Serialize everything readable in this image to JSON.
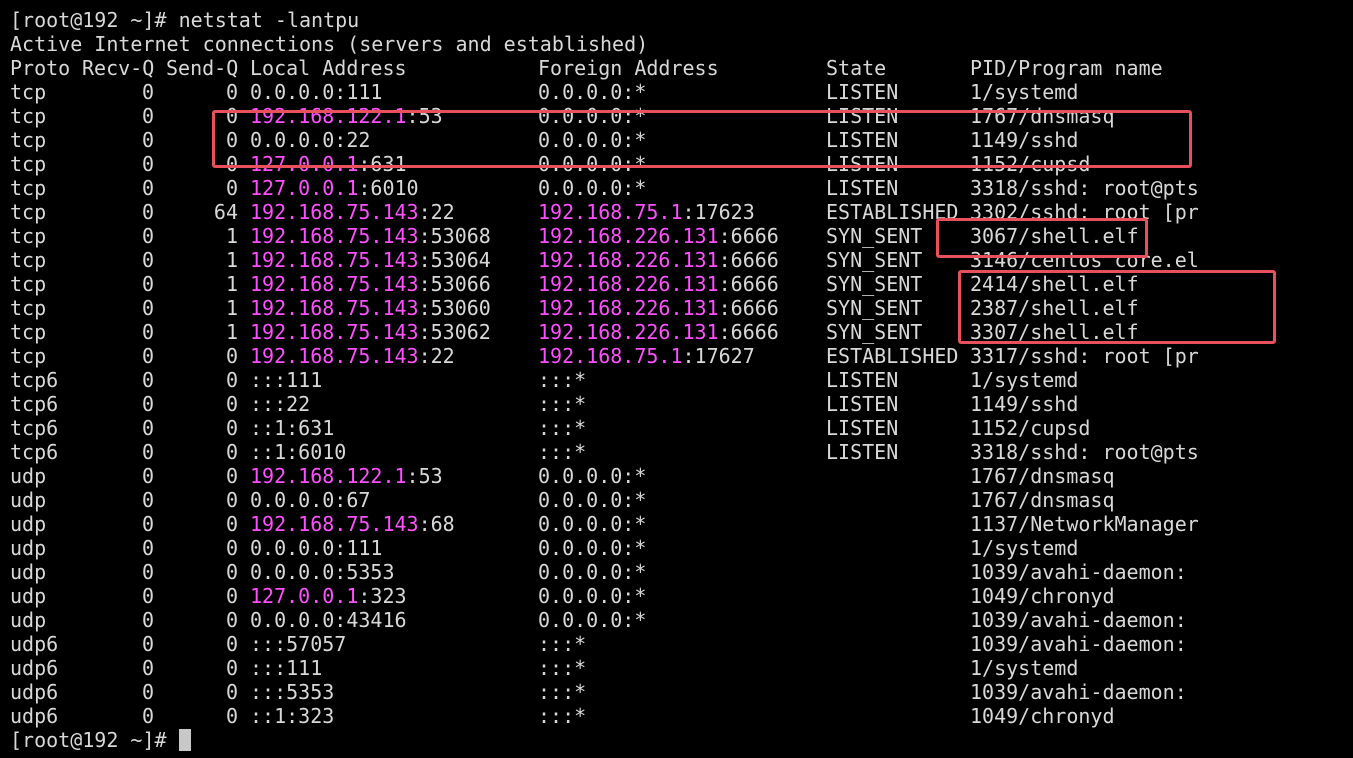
{
  "terminal": {
    "prompt": "[root@192 ~]#",
    "command": "netstat -lantpu",
    "summary_line": "Active Internet connections (servers and established)",
    "headers": {
      "proto": "Proto",
      "recv_q": "Recv-Q",
      "send_q": "Send-Q",
      "local": "Local Address",
      "foreign": "Foreign Address",
      "state": "State",
      "program": "PID/Program name"
    },
    "rows": [
      {
        "proto": "tcp",
        "recv": "0",
        "send": "0",
        "local_ip": "0.0.0.0",
        "local_ip_hl": false,
        "local_port": ":111",
        "foreign_ip": "0.0.0.0",
        "foreign_ip_hl": false,
        "foreign_port": ":*",
        "state": "LISTEN",
        "program": "1/systemd"
      },
      {
        "proto": "tcp",
        "recv": "0",
        "send": "0",
        "local_ip": "192.168.122.1",
        "local_ip_hl": true,
        "local_port": ":53",
        "foreign_ip": "0.0.0.0",
        "foreign_ip_hl": false,
        "foreign_port": ":*",
        "state": "LISTEN",
        "program": "1767/dnsmasq"
      },
      {
        "proto": "tcp",
        "recv": "0",
        "send": "0",
        "local_ip": "0.0.0.0",
        "local_ip_hl": false,
        "local_port": ":22",
        "foreign_ip": "0.0.0.0",
        "foreign_ip_hl": false,
        "foreign_port": ":*",
        "state": "LISTEN",
        "program": "1149/sshd"
      },
      {
        "proto": "tcp",
        "recv": "0",
        "send": "0",
        "local_ip": "127.0.0.1",
        "local_ip_hl": true,
        "local_port": ":631",
        "foreign_ip": "0.0.0.0",
        "foreign_ip_hl": false,
        "foreign_port": ":*",
        "state": "LISTEN",
        "program": "1152/cupsd"
      },
      {
        "proto": "tcp",
        "recv": "0",
        "send": "0",
        "local_ip": "127.0.0.1",
        "local_ip_hl": true,
        "local_port": ":6010",
        "foreign_ip": "0.0.0.0",
        "foreign_ip_hl": false,
        "foreign_port": ":*",
        "state": "LISTEN",
        "program": "3318/sshd: root@pts"
      },
      {
        "proto": "tcp",
        "recv": "0",
        "send": "64",
        "local_ip": "192.168.75.143",
        "local_ip_hl": true,
        "local_port": ":22",
        "foreign_ip": "192.168.75.1",
        "foreign_ip_hl": true,
        "foreign_port": ":17623",
        "state": "ESTABLISHED",
        "program": "3302/sshd: root [pr"
      },
      {
        "proto": "tcp",
        "recv": "0",
        "send": "1",
        "local_ip": "192.168.75.143",
        "local_ip_hl": true,
        "local_port": ":53068",
        "foreign_ip": "192.168.226.131",
        "foreign_ip_hl": true,
        "foreign_port": ":6666",
        "state": "SYN_SENT",
        "program": "3067/shell.elf"
      },
      {
        "proto": "tcp",
        "recv": "0",
        "send": "1",
        "local_ip": "192.168.75.143",
        "local_ip_hl": true,
        "local_port": ":53064",
        "foreign_ip": "192.168.226.131",
        "foreign_ip_hl": true,
        "foreign_port": ":6666",
        "state": "SYN_SENT",
        "program": "3146/centos core.el"
      },
      {
        "proto": "tcp",
        "recv": "0",
        "send": "1",
        "local_ip": "192.168.75.143",
        "local_ip_hl": true,
        "local_port": ":53066",
        "foreign_ip": "192.168.226.131",
        "foreign_ip_hl": true,
        "foreign_port": ":6666",
        "state": "SYN_SENT",
        "program": "2414/shell.elf"
      },
      {
        "proto": "tcp",
        "recv": "0",
        "send": "1",
        "local_ip": "192.168.75.143",
        "local_ip_hl": true,
        "local_port": ":53060",
        "foreign_ip": "192.168.226.131",
        "foreign_ip_hl": true,
        "foreign_port": ":6666",
        "state": "SYN_SENT",
        "program": "2387/shell.elf"
      },
      {
        "proto": "tcp",
        "recv": "0",
        "send": "1",
        "local_ip": "192.168.75.143",
        "local_ip_hl": true,
        "local_port": ":53062",
        "foreign_ip": "192.168.226.131",
        "foreign_ip_hl": true,
        "foreign_port": ":6666",
        "state": "SYN_SENT",
        "program": "3307/shell.elf"
      },
      {
        "proto": "tcp",
        "recv": "0",
        "send": "0",
        "local_ip": "192.168.75.143",
        "local_ip_hl": true,
        "local_port": ":22",
        "foreign_ip": "192.168.75.1",
        "foreign_ip_hl": true,
        "foreign_port": ":17627",
        "state": "ESTABLISHED",
        "program": "3317/sshd: root [pr"
      },
      {
        "proto": "tcp6",
        "recv": "0",
        "send": "0",
        "local_ip": "",
        "local_ip_hl": false,
        "local_port": ":::111",
        "foreign_ip": "",
        "foreign_ip_hl": false,
        "foreign_port": ":::*",
        "state": "LISTEN",
        "program": "1/systemd"
      },
      {
        "proto": "tcp6",
        "recv": "0",
        "send": "0",
        "local_ip": "",
        "local_ip_hl": false,
        "local_port": ":::22",
        "foreign_ip": "",
        "foreign_ip_hl": false,
        "foreign_port": ":::*",
        "state": "LISTEN",
        "program": "1149/sshd"
      },
      {
        "proto": "tcp6",
        "recv": "0",
        "send": "0",
        "local_ip": "",
        "local_ip_hl": false,
        "local_port": "::1:631",
        "foreign_ip": "",
        "foreign_ip_hl": false,
        "foreign_port": ":::*",
        "state": "LISTEN",
        "program": "1152/cupsd"
      },
      {
        "proto": "tcp6",
        "recv": "0",
        "send": "0",
        "local_ip": "",
        "local_ip_hl": false,
        "local_port": "::1:6010",
        "foreign_ip": "",
        "foreign_ip_hl": false,
        "foreign_port": ":::*",
        "state": "LISTEN",
        "program": "3318/sshd: root@pts"
      },
      {
        "proto": "udp",
        "recv": "0",
        "send": "0",
        "local_ip": "192.168.122.1",
        "local_ip_hl": true,
        "local_port": ":53",
        "foreign_ip": "0.0.0.0",
        "foreign_ip_hl": false,
        "foreign_port": ":*",
        "state": "",
        "program": "1767/dnsmasq"
      },
      {
        "proto": "udp",
        "recv": "0",
        "send": "0",
        "local_ip": "0.0.0.0",
        "local_ip_hl": false,
        "local_port": ":67",
        "foreign_ip": "0.0.0.0",
        "foreign_ip_hl": false,
        "foreign_port": ":*",
        "state": "",
        "program": "1767/dnsmasq"
      },
      {
        "proto": "udp",
        "recv": "0",
        "send": "0",
        "local_ip": "192.168.75.143",
        "local_ip_hl": true,
        "local_port": ":68",
        "foreign_ip": "0.0.0.0",
        "foreign_ip_hl": false,
        "foreign_port": ":*",
        "state": "",
        "program": "1137/NetworkManager"
      },
      {
        "proto": "udp",
        "recv": "0",
        "send": "0",
        "local_ip": "0.0.0.0",
        "local_ip_hl": false,
        "local_port": ":111",
        "foreign_ip": "0.0.0.0",
        "foreign_ip_hl": false,
        "foreign_port": ":*",
        "state": "",
        "program": "1/systemd"
      },
      {
        "proto": "udp",
        "recv": "0",
        "send": "0",
        "local_ip": "0.0.0.0",
        "local_ip_hl": false,
        "local_port": ":5353",
        "foreign_ip": "0.0.0.0",
        "foreign_ip_hl": false,
        "foreign_port": ":*",
        "state": "",
        "program": "1039/avahi-daemon:"
      },
      {
        "proto": "udp",
        "recv": "0",
        "send": "0",
        "local_ip": "127.0.0.1",
        "local_ip_hl": true,
        "local_port": ":323",
        "foreign_ip": "0.0.0.0",
        "foreign_ip_hl": false,
        "foreign_port": ":*",
        "state": "",
        "program": "1049/chronyd"
      },
      {
        "proto": "udp",
        "recv": "0",
        "send": "0",
        "local_ip": "0.0.0.0",
        "local_ip_hl": false,
        "local_port": ":43416",
        "foreign_ip": "0.0.0.0",
        "foreign_ip_hl": false,
        "foreign_port": ":*",
        "state": "",
        "program": "1039/avahi-daemon:"
      },
      {
        "proto": "udp6",
        "recv": "0",
        "send": "0",
        "local_ip": "",
        "local_ip_hl": false,
        "local_port": ":::57057",
        "foreign_ip": "",
        "foreign_ip_hl": false,
        "foreign_port": ":::*",
        "state": "",
        "program": "1039/avahi-daemon:"
      },
      {
        "proto": "udp6",
        "recv": "0",
        "send": "0",
        "local_ip": "",
        "local_ip_hl": false,
        "local_port": ":::111",
        "foreign_ip": "",
        "foreign_ip_hl": false,
        "foreign_port": ":::*",
        "state": "",
        "program": "1/systemd"
      },
      {
        "proto": "udp6",
        "recv": "0",
        "send": "0",
        "local_ip": "",
        "local_ip_hl": false,
        "local_port": ":::5353",
        "foreign_ip": "",
        "foreign_ip_hl": false,
        "foreign_port": ":::*",
        "state": "",
        "program": "1039/avahi-daemon:"
      },
      {
        "proto": "udp6",
        "recv": "0",
        "send": "0",
        "local_ip": "",
        "local_ip_hl": false,
        "local_port": "::1:323",
        "foreign_ip": "",
        "foreign_ip_hl": false,
        "foreign_port": ":::*",
        "state": "",
        "program": "1049/chronyd"
      }
    ]
  },
  "colors": {
    "background": "#000000",
    "text": "#d8d8d8",
    "ip_highlight": "#ff4fff",
    "annotation_box": "#e8505b"
  }
}
